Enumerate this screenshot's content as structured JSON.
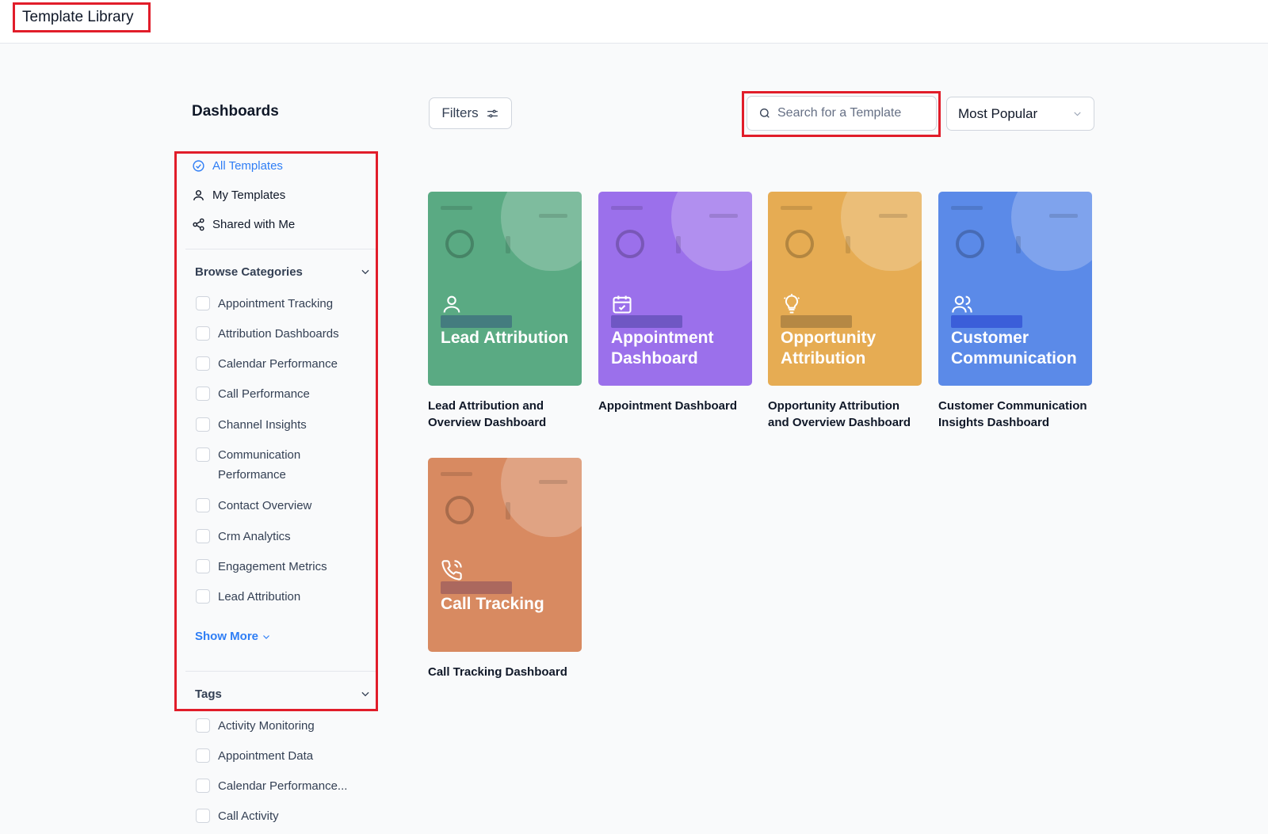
{
  "app": {
    "title": "Template Library"
  },
  "sidebar": {
    "title": "Dashboards",
    "nav": [
      {
        "label": "All Templates",
        "icon": "check-circle-icon",
        "active": true
      },
      {
        "label": "My Templates",
        "icon": "user-icon",
        "active": false
      },
      {
        "label": "Shared with Me",
        "icon": "share-icon",
        "active": false
      }
    ],
    "categories": {
      "title": "Browse Categories",
      "items": [
        "Appointment Tracking",
        "Attribution Dashboards",
        "Calendar Performance",
        "Call Performance",
        "Channel Insights",
        "Communication Performance",
        "Contact Overview",
        "Crm Analytics",
        "Engagement Metrics",
        "Lead Attribution"
      ],
      "show_more": "Show More"
    },
    "tags": {
      "title": "Tags",
      "items": [
        "Activity Monitoring",
        "Appointment Data",
        "Calendar Performance...",
        "Call Activity"
      ]
    }
  },
  "toolbar": {
    "filters_label": "Filters",
    "search_placeholder": "Search for a Template",
    "sort_label": "Most Popular"
  },
  "templates": [
    {
      "title": "Lead Attribution",
      "caption": "Lead Attribution and Overview Dashboard",
      "color": "#5aaa83",
      "icon": "user-icon"
    },
    {
      "title": "Appointment Dashboard",
      "caption": "Appointment Dashboard",
      "color": "#9b70eb",
      "icon": "calendar-check-icon"
    },
    {
      "title": "Opportunity Attribution",
      "caption": "Opportunity Attribution and Overview Dashboard",
      "color": "#e6ac53",
      "icon": "lightbulb-icon"
    },
    {
      "title": "Customer Communication",
      "caption": "Customer Communication Insights Dashboard",
      "color": "#5b8ae8",
      "icon": "users-icon"
    },
    {
      "title": "Call Tracking",
      "caption": "Call Tracking Dashboard",
      "color": "#d88a61",
      "icon": "phone-call-icon"
    }
  ],
  "colors": {
    "accent": "#2f7ef5",
    "highlight": "#e11d2a"
  }
}
